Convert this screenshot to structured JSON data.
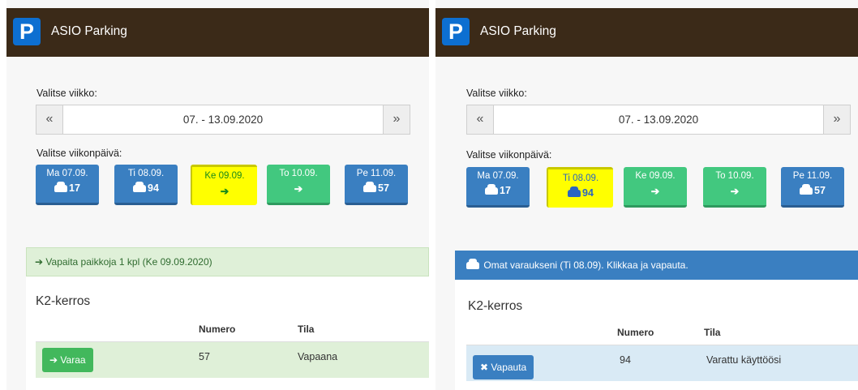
{
  "left": {
    "brand_logo": "P",
    "brand_name": "ASIO Parking",
    "week_label": "Valitse viikko:",
    "week_prev": "«",
    "week_value": "07. - 13.09.2020",
    "week_next": "»",
    "day_label": "Valitse viikonpäivä:",
    "days": [
      {
        "name": "Ma 07.09.",
        "value": "17",
        "icon": "car-icon",
        "state": "blue"
      },
      {
        "name": "Ti 08.09.",
        "value": "94",
        "icon": "car-icon",
        "state": "blue"
      },
      {
        "name": "Ke 09.09.",
        "value": "➔",
        "icon": "arrow-icon",
        "state": "selected-yellow"
      },
      {
        "name": "To 10.09.",
        "value": "➔",
        "icon": "arrow-icon",
        "state": "green"
      },
      {
        "name": "Pe 11.09.",
        "value": "57",
        "icon": "car-icon",
        "state": "blue"
      }
    ],
    "alert_icon": "➔",
    "alert_text": "Vapaita paikkoja 1 kpl (Ke 09.09.2020)",
    "section_title": "K2-kerros",
    "col_number": "Numero",
    "col_status": "Tila",
    "row": {
      "button": "Varaa",
      "button_icon": "➔",
      "number": "57",
      "status": "Vapaana"
    }
  },
  "right": {
    "brand_logo": "P",
    "brand_name": "ASIO Parking",
    "week_label": "Valitse viikko:",
    "week_prev": "«",
    "week_value": "07. - 13.09.2020",
    "week_next": "»",
    "day_label": "Valitse viikonpäivä:",
    "days": [
      {
        "name": "Ma 07.09.",
        "value": "17",
        "icon": "car-icon",
        "state": "blue"
      },
      {
        "name": "Ti 08.09.",
        "value": "94",
        "icon": "car-icon",
        "state": "selected-yellow"
      },
      {
        "name": "Ke 09.09.",
        "value": "➔",
        "icon": "arrow-icon",
        "state": "green"
      },
      {
        "name": "To 10.09.",
        "value": "➔",
        "icon": "arrow-icon",
        "state": "green"
      },
      {
        "name": "Pe 11.09.",
        "value": "57",
        "icon": "car-icon",
        "state": "blue"
      }
    ],
    "alert_text": "Omat varaukseni (Ti 08.09). Klikkaa ja vapauta.",
    "section_title": "K2-kerros",
    "col_number": "Numero",
    "col_status": "Tila",
    "row": {
      "button": "Vapauta",
      "button_icon": "✖",
      "number": "94",
      "status": "Varattu käyttöösi"
    }
  },
  "colors": {
    "navbar": "#3b2a18",
    "logo": "#0d6fd1",
    "day_blue": "#3a7fc1",
    "day_green": "#42c87f",
    "day_selected": "#ffff00",
    "alert_green": "#dff0d8",
    "alert_blue": "#3a7fc1"
  }
}
